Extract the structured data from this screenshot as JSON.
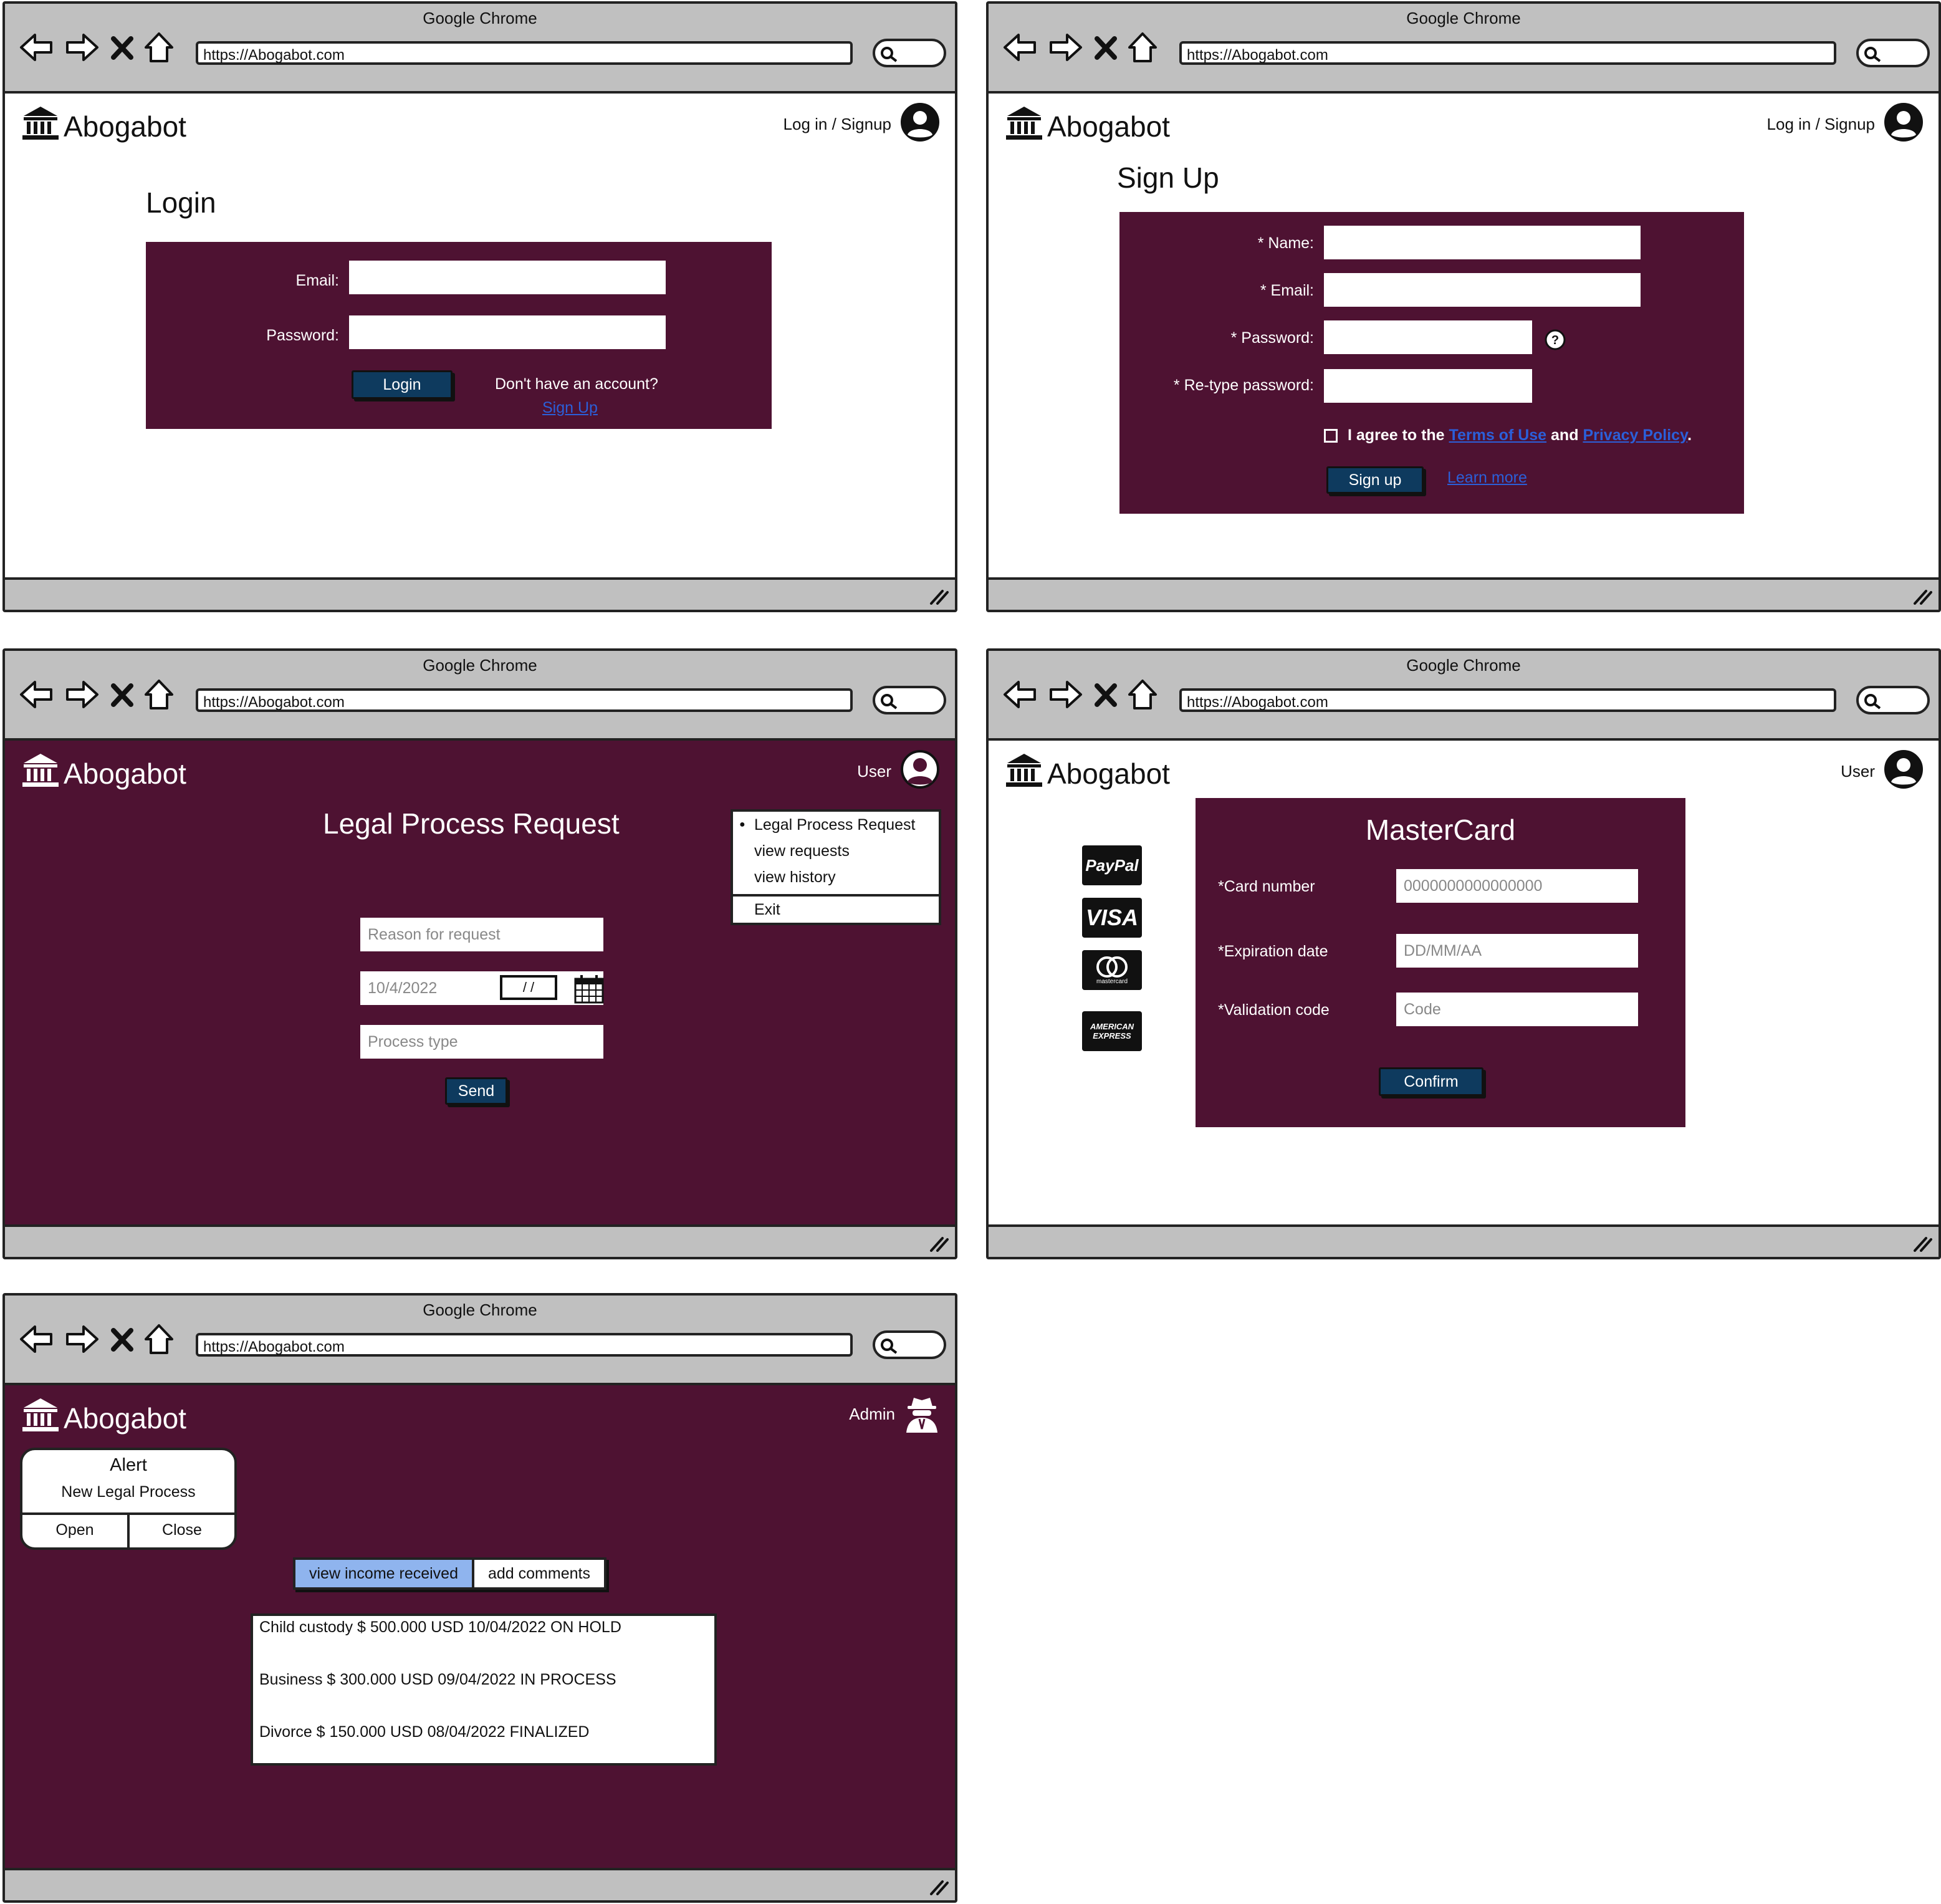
{
  "browser": {
    "title": "Google Chrome",
    "url": "https://Abogabot.com"
  },
  "brand": "Abogabot",
  "login": {
    "account_label": "Log in / Signup",
    "heading": "Login",
    "email_label": "Email:",
    "password_label": "Password:",
    "login_button": "Login",
    "no_account_text": "Don't have an account?",
    "signup_link": "Sign Up"
  },
  "signup": {
    "account_label": "Log in / Signup",
    "heading": "Sign Up",
    "name_label": "* Name:",
    "email_label": "* Email:",
    "password_label": "* Password:",
    "retype_label": "* Re-type password:",
    "agree_prefix": "I agree to the",
    "terms_link": "Terms of Use",
    "and_text": "and",
    "privacy_link": "Privacy Policy",
    "period": ".",
    "signup_button": "Sign up",
    "learn_more": "Learn more"
  },
  "request": {
    "user_label": "User",
    "heading": "Legal Process Request",
    "reason_placeholder": "Reason for request",
    "date_value": "10/4/2022",
    "date_slashes": "/ /",
    "process_placeholder": "Process type",
    "send_button": "Send",
    "menu": [
      "Legal Process Request",
      "view requests",
      "view history",
      "Exit"
    ]
  },
  "payment": {
    "user_label": "User",
    "heading": "MasterCard",
    "card_label": "*Card number",
    "card_placeholder": "0000000000000000",
    "exp_label": "*Expiration date",
    "exp_placeholder": "DD/MM/AA",
    "code_label": "*Validation code",
    "code_placeholder": "Code",
    "confirm_button": "Confirm",
    "icons": [
      "paypal-icon",
      "visa-icon",
      "mastercard-icon",
      "amex-icon"
    ],
    "paypal_text": "PayPal",
    "visa_text": "VISA",
    "mastercard_text": "mastercard",
    "amex_text": "AMERICAN EXPRESS"
  },
  "admin": {
    "user_label": "Admin",
    "alert_title": "Alert",
    "alert_message": "New Legal Process",
    "alert_open": "Open",
    "alert_close": "Close",
    "tab_income": "view income received",
    "tab_comments": "add comments",
    "rows": [
      "Child custody $ 500.000 USD  10/04/2022  ON HOLD",
      "Business $ 300.000 USD  09/04/2022  IN PROCESS",
      "Divorce $ 150.000 USD  08/04/2022   FINALIZED"
    ]
  },
  "colors": {
    "maroon": "#4e1232",
    "button": "#0e3a5e",
    "chrome": "#c0c0c0",
    "link": "#2b5fd9",
    "tab_active": "#8fb4ee"
  }
}
